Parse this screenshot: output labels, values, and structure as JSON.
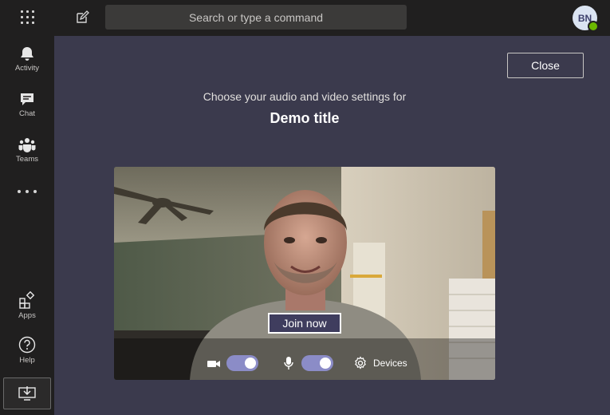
{
  "search": {
    "placeholder": "Search or type a command"
  },
  "user": {
    "initials": "BN",
    "presence_color": "#6bb700"
  },
  "rail": {
    "items": [
      {
        "label": "Activity",
        "icon": "bell-icon"
      },
      {
        "label": "Chat",
        "icon": "chat-icon"
      },
      {
        "label": "Teams",
        "icon": "teams-icon"
      },
      {
        "label": "Apps",
        "icon": "apps-icon"
      },
      {
        "label": "Help",
        "icon": "help-icon"
      }
    ]
  },
  "prejoin": {
    "close_label": "Close",
    "subtitle": "Choose your audio and video settings for",
    "meeting_title": "Demo title",
    "join_label": "Join now",
    "camera_on": true,
    "mic_on": true,
    "devices_label": "Devices"
  },
  "colors": {
    "accent": "#8b8cc7",
    "stage_bg": "#3b3a4d",
    "chrome_bg": "#201f1f"
  }
}
